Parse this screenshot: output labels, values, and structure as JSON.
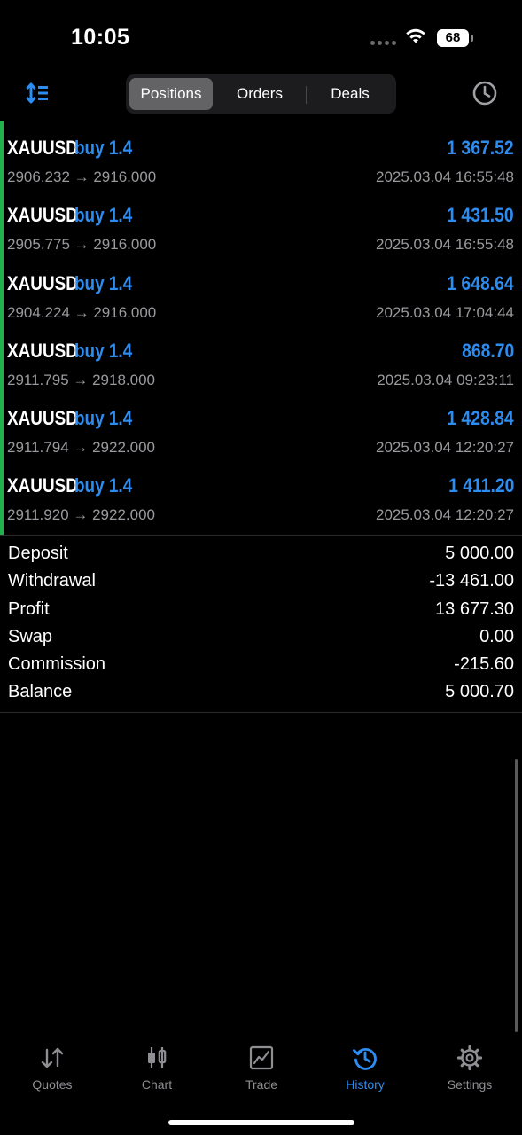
{
  "status_bar": {
    "time": "10:05",
    "battery": "68"
  },
  "toolbar": {
    "segments": [
      {
        "label": "Positions",
        "active": true
      },
      {
        "label": "Orders",
        "active": false
      },
      {
        "label": "Deals",
        "active": false
      }
    ],
    "sort_icon": "sort-icon",
    "clock_icon": "clock-icon"
  },
  "positions": [
    {
      "symbol": "XAUUSD",
      "side": "buy 1.4",
      "profit": "1 367.52",
      "prices": "2906.232 → 2916.000",
      "time": "2025.03.04 16:55:48"
    },
    {
      "symbol": "XAUUSD",
      "side": "buy 1.4",
      "profit": "1 431.50",
      "prices": "2905.775 → 2916.000",
      "time": "2025.03.04 16:55:48"
    },
    {
      "symbol": "XAUUSD",
      "side": "buy 1.4",
      "profit": "1 648.64",
      "prices": "2904.224 → 2916.000",
      "time": "2025.03.04 17:04:44"
    },
    {
      "symbol": "XAUUSD",
      "side": "buy 1.4",
      "profit": "868.70",
      "prices": "2911.795 → 2918.000",
      "time": "2025.03.04 09:23:11"
    },
    {
      "symbol": "XAUUSD",
      "side": "buy 1.4",
      "profit": "1 428.84",
      "prices": "2911.794 → 2922.000",
      "time": "2025.03.04 12:20:27"
    },
    {
      "symbol": "XAUUSD",
      "side": "buy 1.4",
      "profit": "1 411.20",
      "prices": "2911.920 → 2922.000",
      "time": "2025.03.04 12:20:27"
    }
  ],
  "summary": [
    {
      "label": "Deposit",
      "value": "5 000.00"
    },
    {
      "label": "Withdrawal",
      "value": "-13 461.00"
    },
    {
      "label": "Profit",
      "value": "13 677.30"
    },
    {
      "label": "Swap",
      "value": "0.00"
    },
    {
      "label": "Commission",
      "value": "-215.60"
    },
    {
      "label": "Balance",
      "value": "5 000.70"
    }
  ],
  "tabs": [
    {
      "label": "Quotes",
      "icon": "quotes-icon",
      "active": false
    },
    {
      "label": "Chart",
      "icon": "chart-icon",
      "active": false
    },
    {
      "label": "Trade",
      "icon": "trade-icon",
      "active": false
    },
    {
      "label": "History",
      "icon": "history-icon",
      "active": true
    },
    {
      "label": "Settings",
      "icon": "settings-icon",
      "active": false
    }
  ],
  "colors": {
    "accent": "#2d8cf0",
    "profit_bar": "#21b04b",
    "background": "#000000",
    "secondary_text": "#9a9a9e"
  }
}
